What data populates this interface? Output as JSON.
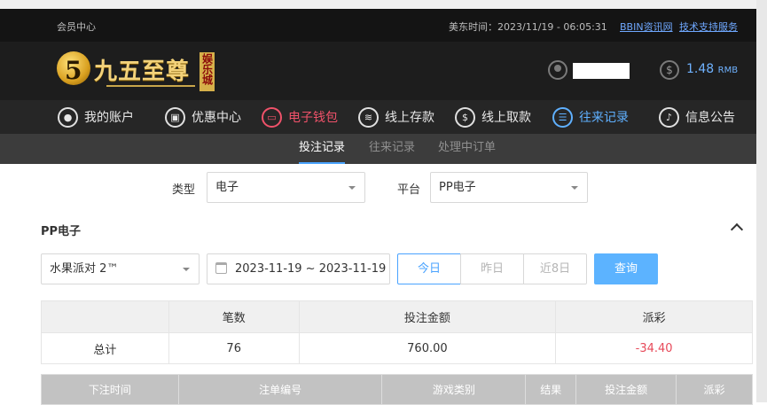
{
  "topbar": {
    "member_center": "会员中心",
    "us_east_time": "美东时间：2023/11/19 - 06:05:31",
    "news_link": "BBIN资讯网",
    "support_link": "技术支持服务"
  },
  "header": {
    "logo_name": "九五至尊",
    "logo_tag": "娱乐城",
    "balance": "1.48",
    "currency": "RMB"
  },
  "nav": {
    "items": [
      {
        "label": "我的账户",
        "icon": "user-icon"
      },
      {
        "label": "优惠中心",
        "icon": "gift-icon"
      },
      {
        "label": "电子钱包",
        "icon": "wallet-icon"
      },
      {
        "label": "线上存款",
        "icon": "deposit-icon"
      },
      {
        "label": "线上取款",
        "icon": "withdraw-icon"
      },
      {
        "label": "往来记录",
        "icon": "records-icon"
      },
      {
        "label": "信息公告",
        "icon": "bell-icon"
      }
    ],
    "active_index": 5
  },
  "subtabs": [
    "投注记录",
    "往来记录",
    "处理中订单"
  ],
  "filters": {
    "type_label": "类型",
    "type_value": "电子",
    "platform_label": "平台",
    "platform_value": "PP电子"
  },
  "section": {
    "title": "PP电子",
    "game_value": "水果派对 2™",
    "date_range": "2023-11-19 ~ 2023-11-19",
    "ranges": [
      "今日",
      "昨日",
      "近8日"
    ],
    "query_button": "查询"
  },
  "summary": {
    "headers": [
      "",
      "笔数",
      "投注金额",
      "派彩"
    ],
    "row": [
      "总计",
      "76",
      "760.00",
      "-34.40"
    ]
  },
  "detail": {
    "headers": [
      "下注时间",
      "注单编号",
      "游戏类别",
      "结果",
      "投注金额",
      "派彩"
    ]
  },
  "colors": {
    "accent": "#4aa3ff",
    "negative": "#e74a5a",
    "active_nav_red": "#f0526a",
    "active_nav_blue": "#5fb0ff"
  }
}
